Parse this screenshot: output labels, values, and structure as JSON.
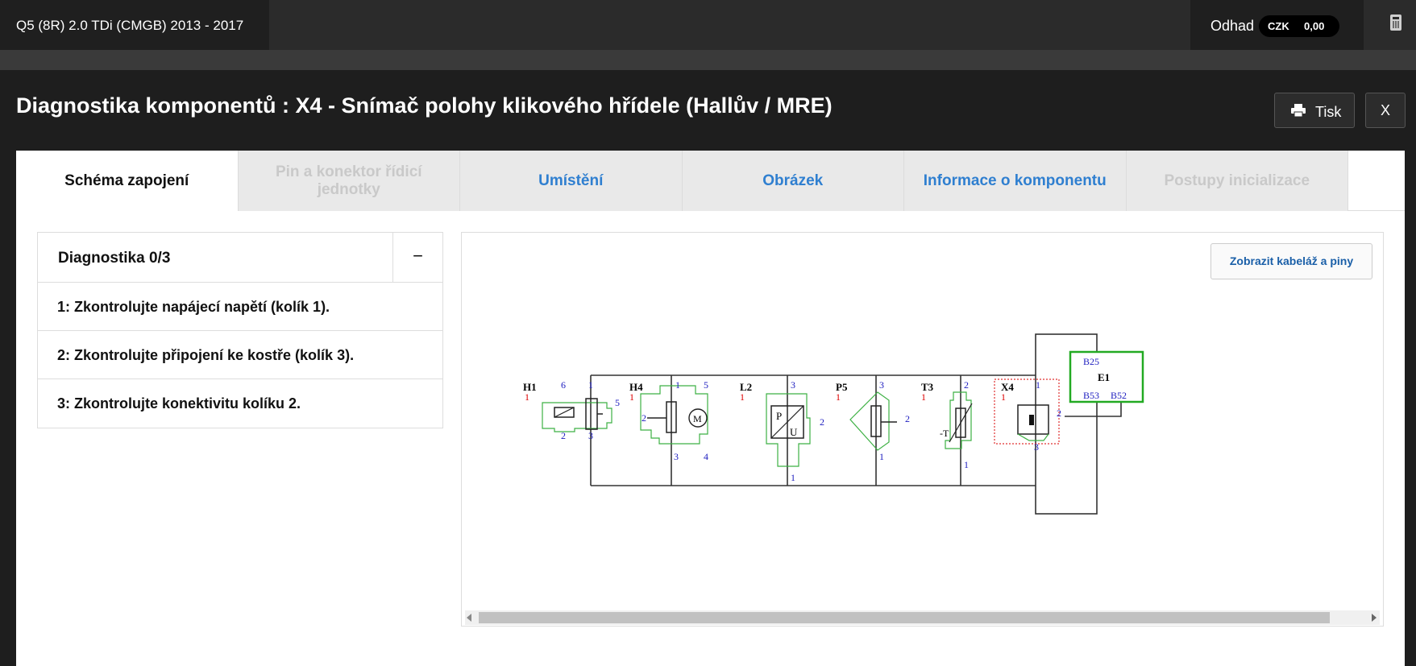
{
  "topbar": {
    "vehicle": "Q5 (8R) 2.0 TDi (CMGB) 2013 - 2017",
    "estimate_label": "Odhad",
    "currency": "CZK",
    "amount": "0,00"
  },
  "modal": {
    "title": "Diagnostika komponentů : X4 - Snímač polohy klikového hřídele (Hallův / MRE)",
    "print_label": "Tisk",
    "close_label": "X"
  },
  "tabs": [
    {
      "label": "Schéma zapojení",
      "state": "active"
    },
    {
      "label": "Pin a konektor řídicí jednotky",
      "state": "disabled"
    },
    {
      "label": "Umístění",
      "state": "enabled"
    },
    {
      "label": "Obrázek",
      "state": "enabled"
    },
    {
      "label": "Informace o komponentu",
      "state": "enabled"
    },
    {
      "label": "Postupy inicializace",
      "state": "disabled"
    }
  ],
  "diagnostics": {
    "title": "Diagnostika 0/3",
    "toggle": "−",
    "items": [
      "1: Zkontrolujte napájecí napětí (kolík 1).",
      "2: Zkontrolujte připojení ke kostře (kolík 3).",
      "3: Zkontrolujte konektivitu kolíku 2."
    ]
  },
  "schematic": {
    "button_label": "Zobrazit kabeláž a piny",
    "components": [
      {
        "id": "H1",
        "count": "1",
        "pins": [
          "6",
          "1",
          "5",
          "2",
          "3"
        ]
      },
      {
        "id": "H4",
        "count": "1",
        "pins": [
          "1",
          "5",
          "2",
          "3",
          "4"
        ]
      },
      {
        "id": "L2",
        "count": "1",
        "pins": [
          "3",
          "2",
          "1"
        ],
        "labels": [
          "P",
          "U"
        ]
      },
      {
        "id": "P5",
        "count": "1",
        "pins": [
          "3",
          "2",
          "1"
        ]
      },
      {
        "id": "T3",
        "count": "1",
        "pins": [
          "2",
          "1"
        ],
        "labels": [
          "-T"
        ]
      },
      {
        "id": "X4",
        "count": "1",
        "pins": [
          "1",
          "2",
          "3"
        ]
      }
    ],
    "ecu": {
      "id": "E1",
      "pins": [
        "B25",
        "B53",
        "B52"
      ]
    },
    "motor_label": "M"
  },
  "colors": {
    "background": "#1e1e1e",
    "tab_link": "#2f7fd0",
    "component_outline": "#3cb043",
    "ecu_outline": "#22aa22",
    "pin_blue": "#2020c0",
    "count_red": "#dd0000",
    "highlight_red": "#e03030"
  }
}
